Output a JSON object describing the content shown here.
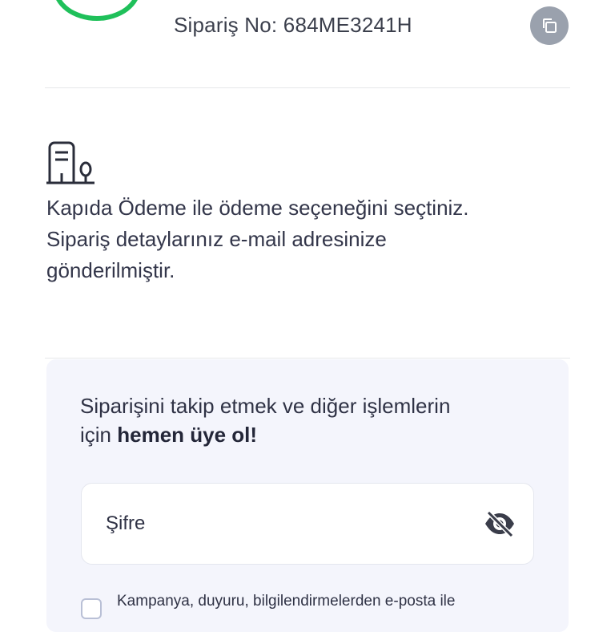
{
  "order": {
    "number_label": "Sipariş No: 684ME3241H",
    "copy_icon": "copy-icon"
  },
  "payment": {
    "icon": "store-icon",
    "message_line1": "Kapıda Ödeme ile ödeme seçeneğini seçtiniz.",
    "message_line2": "Sipariş detaylarınız e-mail adresinize",
    "message_line3": "gönderilmiştir."
  },
  "membership": {
    "title_plain": "Siparişini takip etmek ve diğer işlemlerin",
    "title_prefix": "için ",
    "title_bold": "hemen üye ol!",
    "password_label": "Şifre",
    "eye_icon": "eye-off-icon",
    "consent_text": "Kampanya, duyuru, bilgilendirmelerden e-posta ile"
  },
  "colors": {
    "success": "#1fc05a",
    "copy_button_bg": "#9aa1ad",
    "card_bg": "#f4f5fc"
  }
}
